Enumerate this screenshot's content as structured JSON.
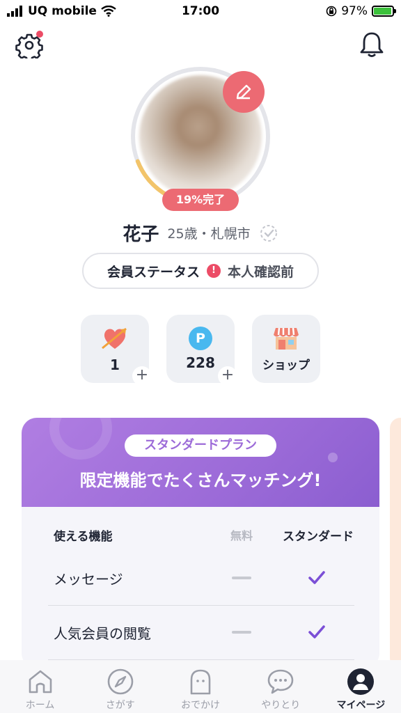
{
  "status_bar": {
    "carrier": "UQ mobile",
    "time": "17:00",
    "battery": "97%"
  },
  "header": {
    "settings_icon": "gear-icon",
    "notification_icon": "bell-icon"
  },
  "profile": {
    "progress_label": "19%完了",
    "progress_value": 0.19,
    "name": "花子",
    "age_city": "25歳・札幌市"
  },
  "member_status": {
    "label": "会員ステータス",
    "warning_icon": "!",
    "value": "本人確認前"
  },
  "tiles": [
    {
      "icon": "heart-arrow-icon",
      "value": "1",
      "plus": "+"
    },
    {
      "icon": "point-icon",
      "icon_text": "P",
      "value": "228",
      "plus": "+"
    },
    {
      "icon": "shop-icon",
      "label": "ショップ"
    }
  ],
  "plan": {
    "badge": "スタンダードプラン",
    "title": "限定機能でたくさんマッチング!",
    "table": {
      "col_feature": "使える機能",
      "col_free": "無料",
      "col_standard": "スタンダード",
      "rows": [
        {
          "feature": "メッセージ",
          "free": false,
          "standard": true
        },
        {
          "feature": "人気会員の閲覧",
          "free": false,
          "standard": true
        }
      ]
    }
  },
  "tab_bar": {
    "tabs": [
      {
        "label": "ホーム",
        "icon": "home-icon"
      },
      {
        "label": "さがす",
        "icon": "compass-icon"
      },
      {
        "label": "おでかけ",
        "icon": "ghost-icon"
      },
      {
        "label": "やりとり",
        "icon": "chat-bubble-icon"
      },
      {
        "label": "マイページ",
        "icon": "user-icon",
        "active": true
      }
    ]
  },
  "colors": {
    "accent": "#ec6a73",
    "plan_purple": "#9c6bd8",
    "check": "#7b4fd6",
    "progress": "#f2c46a"
  }
}
